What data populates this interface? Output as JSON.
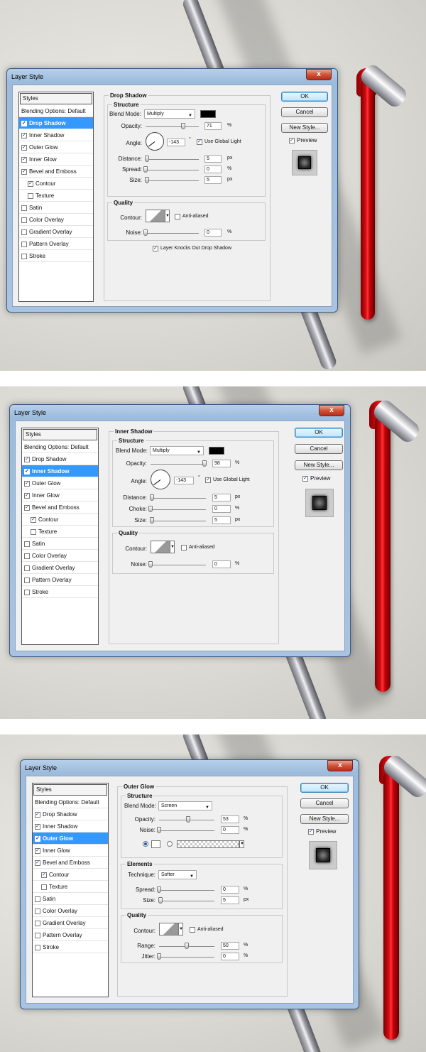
{
  "panels": [
    {
      "window_title": "Layer Style",
      "close_label": "x",
      "list_header": "Styles",
      "items": [
        {
          "label": "Blending Options: Default",
          "checked": null,
          "selected": false,
          "sub": false
        },
        {
          "label": "Drop Shadow",
          "checked": true,
          "selected": true,
          "sub": false
        },
        {
          "label": "Inner Shadow",
          "checked": true,
          "selected": false,
          "sub": false
        },
        {
          "label": "Outer Glow",
          "checked": true,
          "selected": false,
          "sub": false
        },
        {
          "label": "Inner Glow",
          "checked": true,
          "selected": false,
          "sub": false
        },
        {
          "label": "Bevel and Emboss",
          "checked": true,
          "selected": false,
          "sub": false
        },
        {
          "label": "Contour",
          "checked": true,
          "selected": false,
          "sub": true
        },
        {
          "label": "Texture",
          "checked": false,
          "selected": false,
          "sub": true
        },
        {
          "label": "Satin",
          "checked": false,
          "selected": false,
          "sub": false
        },
        {
          "label": "Color Overlay",
          "checked": false,
          "selected": false,
          "sub": false
        },
        {
          "label": "Gradient Overlay",
          "checked": false,
          "selected": false,
          "sub": false
        },
        {
          "label": "Pattern Overlay",
          "checked": false,
          "selected": false,
          "sub": false
        },
        {
          "label": "Stroke",
          "checked": false,
          "selected": false,
          "sub": false
        }
      ],
      "buttons": {
        "ok": "OK",
        "cancel": "Cancel",
        "new_style": "New Style...",
        "preview": "Preview"
      },
      "section_title": "Drop Shadow",
      "structure_title": "Structure",
      "blend_mode_label": "Blend Mode:",
      "blend_mode_value": "Multiply",
      "swatch_color": "#000000",
      "opacity_label": "Opacity:",
      "opacity_value": "71",
      "opacity_pct": 0.71,
      "angle_label": "Angle:",
      "angle_value": "-143",
      "angle_unit": "°",
      "global_light_label": "Use Global Light",
      "distance_label": "Distance:",
      "distance_value": "5",
      "distance_unit": "px",
      "spread_label": "Spread:",
      "spread_value": "0",
      "spread_unit": "%",
      "size_label": "Size:",
      "size_value": "5",
      "size_unit": "px",
      "quality_title": "Quality",
      "contour_label": "Contour:",
      "anti_aliased_label": "Anti-aliased",
      "noise_label": "Noise:",
      "noise_value": "0",
      "noise_unit": "%",
      "knockout_label": "Layer Knocks Out Drop Shadow",
      "pct_unit": "%"
    },
    {
      "window_title": "Layer Style",
      "close_label": "x",
      "list_header": "Styles",
      "items": [
        {
          "label": "Blending Options: Default",
          "checked": null,
          "selected": false,
          "sub": false
        },
        {
          "label": "Drop Shadow",
          "checked": true,
          "selected": false,
          "sub": false
        },
        {
          "label": "Inner Shadow",
          "checked": true,
          "selected": true,
          "sub": false
        },
        {
          "label": "Outer Glow",
          "checked": true,
          "selected": false,
          "sub": false
        },
        {
          "label": "Inner Glow",
          "checked": true,
          "selected": false,
          "sub": false
        },
        {
          "label": "Bevel and Emboss",
          "checked": true,
          "selected": false,
          "sub": false
        },
        {
          "label": "Contour",
          "checked": true,
          "selected": false,
          "sub": true
        },
        {
          "label": "Texture",
          "checked": false,
          "selected": false,
          "sub": true
        },
        {
          "label": "Satin",
          "checked": false,
          "selected": false,
          "sub": false
        },
        {
          "label": "Color Overlay",
          "checked": false,
          "selected": false,
          "sub": false
        },
        {
          "label": "Gradient Overlay",
          "checked": false,
          "selected": false,
          "sub": false
        },
        {
          "label": "Pattern Overlay",
          "checked": false,
          "selected": false,
          "sub": false
        },
        {
          "label": "Stroke",
          "checked": false,
          "selected": false,
          "sub": false
        }
      ],
      "buttons": {
        "ok": "OK",
        "cancel": "Cancel",
        "new_style": "New Style...",
        "preview": "Preview"
      },
      "section_title": "Inner Shadow",
      "structure_title": "Structure",
      "blend_mode_label": "Blend Mode:",
      "blend_mode_value": "Multiply",
      "swatch_color": "#000000",
      "opacity_label": "Opacity:",
      "opacity_value": "98",
      "opacity_pct": 0.98,
      "angle_label": "Angle:",
      "angle_value": "-143",
      "angle_unit": "°",
      "global_light_label": "Use Global Light",
      "distance_label": "Distance:",
      "distance_value": "5",
      "distance_unit": "px",
      "choke_label": "Choke:",
      "choke_value": "0",
      "choke_unit": "%",
      "size_label": "Size:",
      "size_value": "5",
      "size_unit": "px",
      "quality_title": "Quality",
      "contour_label": "Contour:",
      "anti_aliased_label": "Anti-aliased",
      "noise_label": "Noise:",
      "noise_value": "0",
      "noise_unit": "%",
      "pct_unit": "%"
    },
    {
      "window_title": "Layer Style",
      "close_label": "x",
      "list_header": "Styles",
      "items": [
        {
          "label": "Blending Options: Default",
          "checked": null,
          "selected": false,
          "sub": false
        },
        {
          "label": "Drop Shadow",
          "checked": true,
          "selected": false,
          "sub": false
        },
        {
          "label": "Inner Shadow",
          "checked": true,
          "selected": false,
          "sub": false
        },
        {
          "label": "Outer Glow",
          "checked": true,
          "selected": true,
          "sub": false
        },
        {
          "label": "Inner Glow",
          "checked": true,
          "selected": false,
          "sub": false
        },
        {
          "label": "Bevel and Emboss",
          "checked": true,
          "selected": false,
          "sub": false
        },
        {
          "label": "Contour",
          "checked": true,
          "selected": false,
          "sub": true
        },
        {
          "label": "Texture",
          "checked": false,
          "selected": false,
          "sub": true
        },
        {
          "label": "Satin",
          "checked": false,
          "selected": false,
          "sub": false
        },
        {
          "label": "Color Overlay",
          "checked": false,
          "selected": false,
          "sub": false
        },
        {
          "label": "Gradient Overlay",
          "checked": false,
          "selected": false,
          "sub": false
        },
        {
          "label": "Pattern Overlay",
          "checked": false,
          "selected": false,
          "sub": false
        },
        {
          "label": "Stroke",
          "checked": false,
          "selected": false,
          "sub": false
        }
      ],
      "buttons": {
        "ok": "OK",
        "cancel": "Cancel",
        "new_style": "New Style...",
        "preview": "Preview"
      },
      "section_title": "Outer Glow",
      "structure_title": "Structure",
      "blend_mode_label": "Blend Mode:",
      "blend_mode_value": "Screen",
      "opacity_label": "Opacity:",
      "opacity_value": "53",
      "opacity_pct": 0.53,
      "noise_label": "Noise:",
      "noise_value": "0",
      "noise_unit": "%",
      "elements_title": "Elements",
      "technique_label": "Technique:",
      "technique_value": "Softer",
      "spread_label": "Spread:",
      "spread_value": "0",
      "spread_unit": "%",
      "size_label": "Size:",
      "size_value": "5",
      "size_unit": "px",
      "quality_title": "Quality",
      "contour_label": "Contour:",
      "anti_aliased_label": "Anti-aliased",
      "range_label": "Range:",
      "range_value": "50",
      "range_unit": "%",
      "range_pct": 0.5,
      "jitter_label": "Jitter:",
      "jitter_value": "0",
      "jitter_unit": "%",
      "pct_unit": "%"
    }
  ]
}
